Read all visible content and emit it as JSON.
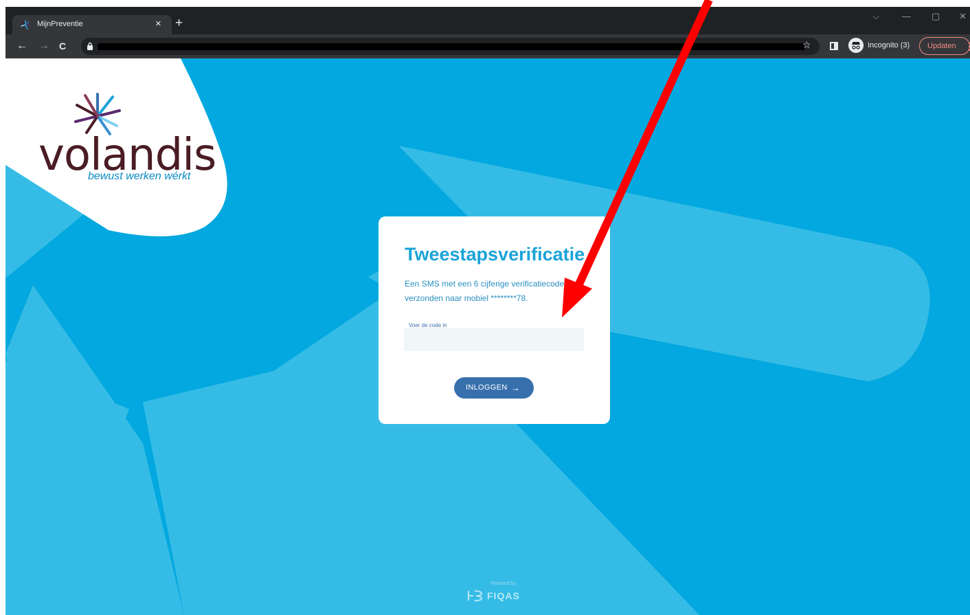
{
  "browser": {
    "tab_title": "MijnPreventie",
    "tab_close": "×",
    "new_tab": "+",
    "incognito_label": "Incognito (3)",
    "update_label": "Updaten",
    "menu": "⋮",
    "back": "←",
    "forward": "→",
    "reload": "C",
    "bookmark": "☆",
    "window_controls": [
      "⌵",
      "—",
      "▢",
      "✕"
    ]
  },
  "logo": {
    "word": "volandis",
    "tagline": "bewust werken wérkt"
  },
  "card": {
    "title": "Tweestapsverificatie",
    "message": "Een SMS met een 6 cijferige verificatiecode is verzonden naar mobiel ********78.",
    "field_label": "Voer de code in",
    "code_value": "",
    "code_placeholder": "",
    "login_label": "INLOGGEN",
    "login_arrow": "→"
  },
  "footer": {
    "powered_by": "Powered by",
    "brand": "FIQAS"
  },
  "colors": {
    "background": "#02a8df",
    "background_shape": "#35bce6",
    "title": "#1aa3d8",
    "button": "#3770ad",
    "logo_text": "#4a1c24",
    "annotation_arrow": "#ff0000"
  },
  "icons": [
    "lock-icon",
    "star-icon",
    "side-panel-icon",
    "incognito-icon",
    "arrow-right-icon",
    "volandis-starburst-icon",
    "fiqas-logo-icon",
    "red-annotation-arrow"
  ]
}
